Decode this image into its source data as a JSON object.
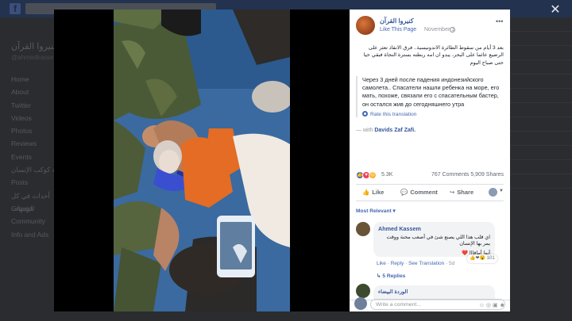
{
  "background": {
    "page_name": "كنيروا القرآن",
    "page_handle": "@ahmedkassem",
    "nav": [
      "Home",
      "About",
      "Twitter",
      "Videos",
      "Photos",
      "Reviews",
      "Events",
      "صنوعة كوكب الإنسان",
      "Posts",
      "أحداث في كل الوجهات",
      "Groups",
      "Community",
      "Info and Ads"
    ]
  },
  "post": {
    "page_name": "كنيروا القرآن",
    "like_label": "Like This Page",
    "date": "November 1",
    "arabic_text": "بعد 3 أيام من سقوط الطائرة الاندونيسية.. فرق الانقاذ تعثر على الرضيع عائما على البحر، يبدو ان امه ربطته بسترة النجاة فبقي حيا حتى صباح اليوم",
    "ru_translation": "Через 3 дней после падения индонезийского самолета.. Спасатели нашли ребенка на море, его мать, похоже, связали его с спасательным бастер, он остался жив до сегодняшнего утра",
    "rate_translation": "Rate this translation",
    "with_prefix": "— with",
    "with_friend": "Davids Zaf Zafi.",
    "reaction_count": "5.3K",
    "comments_shares": "767 Comments  5,909 Shares",
    "actions": {
      "like": "Like",
      "comment": "Comment",
      "share": "Share"
    },
    "sort_label": "Most Relevant ▾"
  },
  "comments": [
    {
      "name": "Ahmed Kassem",
      "text": "اي قلب هذا اللي يصنع شئ في أصعب محنة ووقت يمر بها الإنسان",
      "text2": "أنوا أمافااا ❤️",
      "reaction_count": "101",
      "actions": "Like · Reply · See Translation ·",
      "time": "5d",
      "replies": "5 Replies"
    },
    {
      "name": "الوردة البيضاء"
    }
  ],
  "composer": {
    "placeholder": "Write a comment..."
  },
  "colors": {
    "link": "#365899",
    "like_blue": "#4267b2",
    "love_red": "#f33e58",
    "haha_yellow": "#f7b125"
  }
}
